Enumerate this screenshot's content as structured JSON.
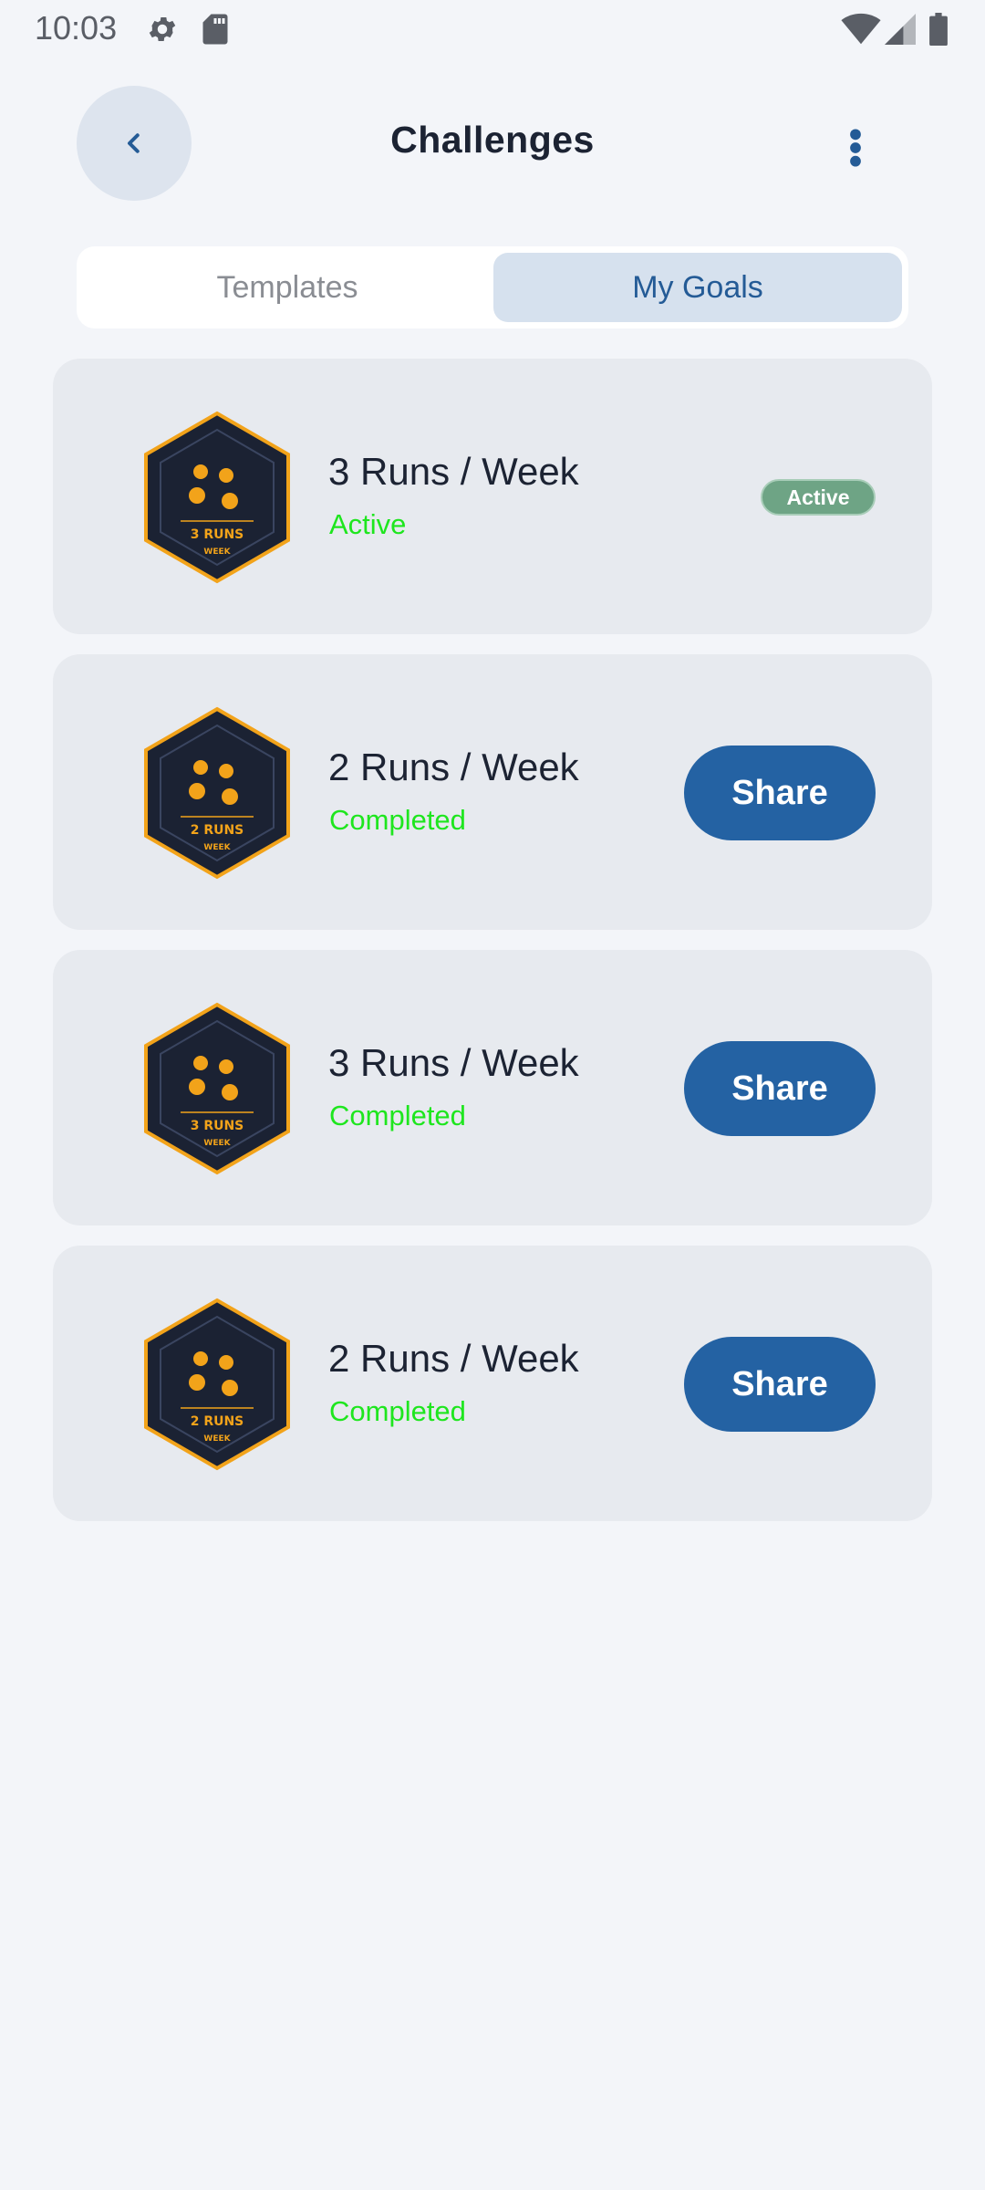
{
  "status_bar": {
    "time": "10:03",
    "icons": [
      "gear-icon",
      "sd-card-icon",
      "wifi-icon",
      "signal-icon",
      "battery-icon"
    ]
  },
  "app_bar": {
    "title": "Challenges",
    "back_icon": "chevron-left-icon",
    "menu_icon": "more-vertical-icon"
  },
  "tabs": [
    {
      "label": "Templates",
      "selected": false
    },
    {
      "label": "My Goals",
      "selected": true
    }
  ],
  "goals": [
    {
      "title": "3 Runs / Week",
      "status": "Active",
      "badge_line1": "3 RUNS",
      "badge_line2": "WEEK",
      "pill": "Active",
      "action": ""
    },
    {
      "title": "2 Runs / Week",
      "status": "Completed",
      "badge_line1": "2 RUNS",
      "badge_line2": "WEEK",
      "pill": "",
      "action": "Share"
    },
    {
      "title": "3 Runs / Week",
      "status": "Completed",
      "badge_line1": "3 RUNS",
      "badge_line2": "WEEK",
      "pill": "",
      "action": "Share"
    },
    {
      "title": "2 Runs / Week",
      "status": "Completed",
      "badge_line1": "2 RUNS",
      "badge_line2": "WEEK",
      "pill": "",
      "action": "Share"
    }
  ],
  "colors": {
    "background": "#f3f5f9",
    "card": "#e7eaef",
    "accent": "#2462a3",
    "status_green": "#1ee61e",
    "active_pill": "#6ea485",
    "badge_dark": "#1b2233",
    "badge_gold": "#f2a31a"
  }
}
